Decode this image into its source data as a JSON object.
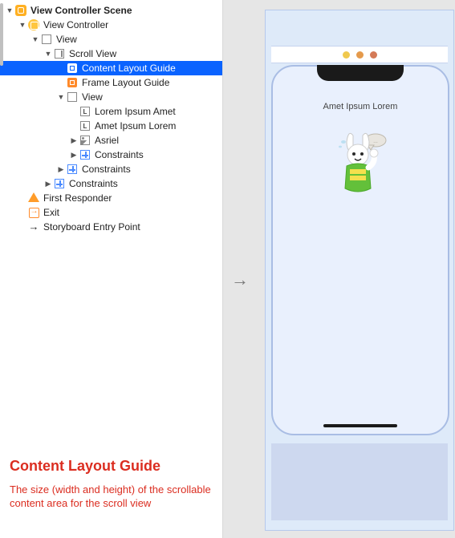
{
  "outline": {
    "scene": "View Controller Scene",
    "vc": "View Controller",
    "view": "View",
    "scrollview": "Scroll View",
    "content_guide": "Content Layout Guide",
    "frame_guide": "Frame Layout Guide",
    "inner_view": "View",
    "label1": "Lorem Ipsum Amet",
    "label2": "Amet Ipsum Lorem",
    "imageview": "Asriel",
    "constraints_inner": "Constraints",
    "constraints_scroll": "Constraints",
    "constraints_root": "Constraints",
    "first_responder": "First Responder",
    "exit": "Exit",
    "entry": "Storyboard Entry Point"
  },
  "annotation": {
    "title": "Content Layout Guide",
    "desc": "The size (width and height) of the scrollable content area for the scroll view"
  },
  "device": {
    "dots": [
      "#f0c94e",
      "#e59a4c",
      "#d47a57"
    ],
    "visible_label": "Amet Ipsum Lorem"
  },
  "glyphs": {
    "tri_open": "▼",
    "tri_closed": "▶",
    "arrow_right": "→",
    "canvas_arrow": "→"
  }
}
